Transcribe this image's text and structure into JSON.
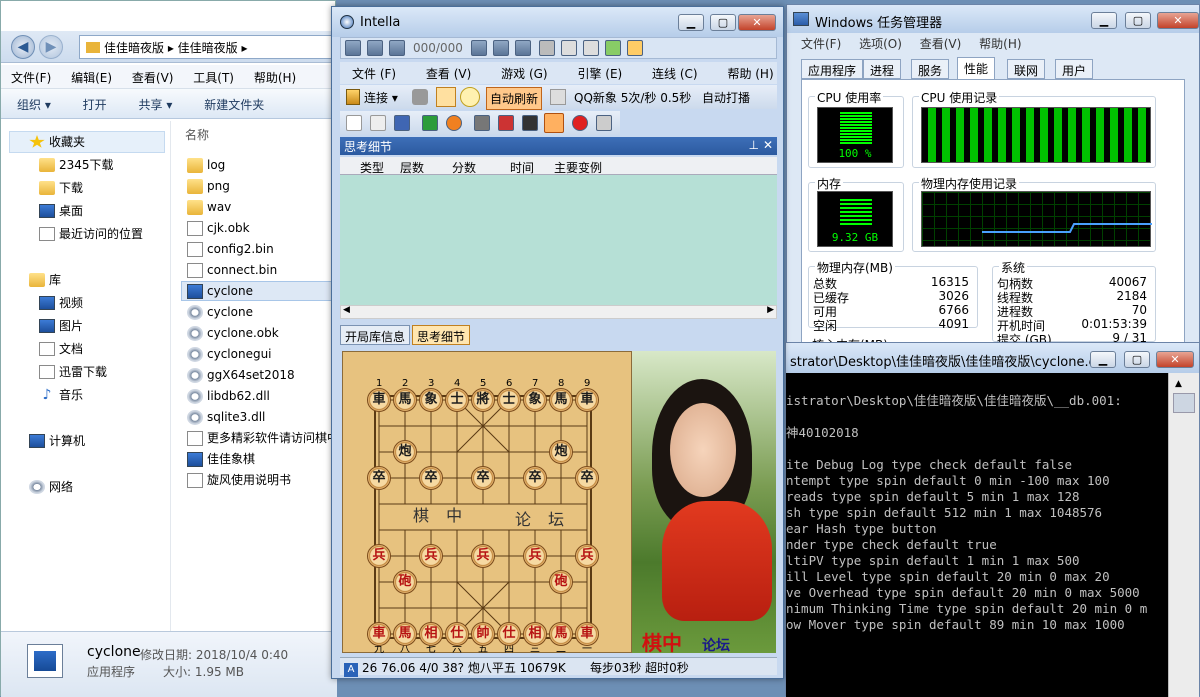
{
  "explorer": {
    "path": [
      "佳佳暗夜版",
      "佳佳暗夜版"
    ],
    "menu": [
      "文件(F)",
      "编辑(E)",
      "查看(V)",
      "工具(T)",
      "帮助(H)"
    ],
    "commands": [
      "组织 ▾",
      "打开",
      "共享 ▾",
      "新建文件夹"
    ],
    "nav": {
      "favorites": "收藏夹",
      "fav_items": [
        "2345下载",
        "下载",
        "桌面",
        "最近访问的位置"
      ],
      "library": "库",
      "lib_items": [
        "视频",
        "图片",
        "文档",
        "迅雷下载",
        "音乐"
      ],
      "computer": "计算机",
      "network": "网络"
    },
    "column_name": "名称",
    "files": [
      {
        "name": "log",
        "type": "folder"
      },
      {
        "name": "png",
        "type": "folder"
      },
      {
        "name": "wav",
        "type": "folder"
      },
      {
        "name": "cjk.obk",
        "type": "doc"
      },
      {
        "name": "config2.bin",
        "type": "doc"
      },
      {
        "name": "connect.bin",
        "type": "doc"
      },
      {
        "name": "cyclone",
        "type": "app"
      },
      {
        "name": "cyclone",
        "type": "gear"
      },
      {
        "name": "cyclone.obk",
        "type": "gear"
      },
      {
        "name": "cyclonegui",
        "type": "gear"
      },
      {
        "name": "ggX64set2018",
        "type": "gear"
      },
      {
        "name": "libdb62.dll",
        "type": "gear"
      },
      {
        "name": "sqlite3.dll",
        "type": "gear"
      },
      {
        "name": "更多精彩软件请访问棋中",
        "type": "doc"
      },
      {
        "name": "佳佳象棋",
        "type": "app"
      },
      {
        "name": "旋风使用说明书",
        "type": "doc"
      }
    ],
    "status": {
      "name": "cyclone",
      "modified_label": "修改日期:",
      "modified": "2018/10/4 0:40",
      "type": "应用程序",
      "size_label": "大小:",
      "size": "1.95 MB"
    }
  },
  "intella": {
    "title": "Intella",
    "move_counter": "000/000",
    "menu": [
      "文件 (F)",
      "查看 (V)",
      "游戏 (G)",
      "引擎 (E)",
      "连线 (C)",
      "帮助 (H)"
    ],
    "connect_label": "连接",
    "auto_refresh": "自动刷新",
    "qq_status": "QQ新象 5次/秒 0.5秒",
    "auto_play": "自动打播",
    "think_title": "思考细节",
    "think_cols": [
      "类型",
      "层数",
      "分数",
      "时间",
      "主要变例"
    ],
    "tabs": [
      "开局库信息",
      "思考细节"
    ],
    "board_text_left": "棋 中",
    "board_text_right": "论 坛",
    "files_top": [
      "1",
      "2",
      "3",
      "4",
      "5",
      "6",
      "7",
      "8",
      "9"
    ],
    "files_bottom": [
      "九",
      "八",
      "七",
      "六",
      "五",
      "四",
      "三",
      "二",
      "一"
    ],
    "photo_caption_1": "棋中",
    "photo_caption_2": "论坛",
    "status_info": "26 76.06 4/0 38? 炮八平五 10679K",
    "status_time": "每步03秒  超时0秒",
    "pieces_black_back": [
      "車",
      "馬",
      "象",
      "士",
      "將",
      "士",
      "象",
      "馬",
      "車"
    ],
    "pieces_black_cannon": "炮",
    "pieces_black_pawn": "卒",
    "pieces_red_back": [
      "車",
      "馬",
      "相",
      "仕",
      "帥",
      "仕",
      "相",
      "馬",
      "車"
    ],
    "pieces_red_cannon": "砲",
    "pieces_red_pawn": "兵"
  },
  "taskmgr": {
    "title": "Windows 任务管理器",
    "menu": [
      "文件(F)",
      "选项(O)",
      "查看(V)",
      "帮助(H)"
    ],
    "tabs": [
      "应用程序",
      "进程",
      "服务",
      "性能",
      "联网",
      "用户"
    ],
    "cpu_usage_label": "CPU 使用率",
    "cpu_usage": "100 %",
    "cpu_history_label": "CPU 使用记录",
    "mem_label": "内存",
    "mem_value": "9.32 GB",
    "mem_history_label": "物理内存使用记录",
    "phys_mem_title": "物理内存(MB)",
    "phys_mem": [
      {
        "k": "总数",
        "v": "16315"
      },
      {
        "k": "已缓存",
        "v": "3026"
      },
      {
        "k": "可用",
        "v": "6766"
      },
      {
        "k": "空闲",
        "v": "4091"
      }
    ],
    "system_title": "系统",
    "system": [
      {
        "k": "句柄数",
        "v": "40067"
      },
      {
        "k": "线程数",
        "v": "2184"
      },
      {
        "k": "进程数",
        "v": "70"
      },
      {
        "k": "开机时间",
        "v": "0:01:53:39"
      },
      {
        "k": "提交 (GB)",
        "v": "9 / 31"
      }
    ],
    "kernel_title": "核心内存(MB)"
  },
  "console": {
    "title": "strator\\Desktop\\佳佳暗夜版\\佳佳暗夜版\\cyclone.exe",
    "lines": [
      "",
      "istrator\\Desktop\\佳佳暗夜版\\佳佳暗夜版\\__db.001:",
      "",
      "神40102018",
      "",
      "ite Debug Log type check default false",
      "ntempt type spin default 0 min -100 max 100",
      "reads type spin default 5 min 1 max 128",
      "sh type spin default 512 min 1 max 1048576",
      "ear Hash type button",
      "nder type check default true",
      "ltiPV type spin default 1 min 1 max 500",
      "ill Level type spin default 20 min 0 max 20",
      "ve Overhead type spin default 20 min 0 max 5000",
      "nimum Thinking Time type spin default 20 min 0 m",
      "ow Mover type spin default 89 min 10 max 1000"
    ]
  },
  "colors": {
    "desktop": "#6d8fb5",
    "think_body": "#b6e0d6",
    "board": "#e7c27f",
    "meter_green": "#00ff00"
  }
}
